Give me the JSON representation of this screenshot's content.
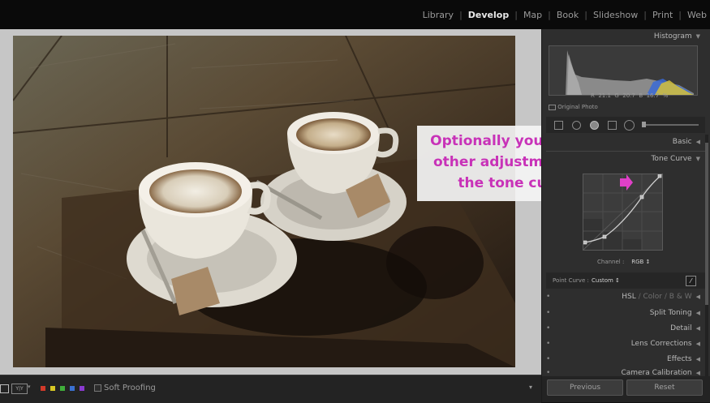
{
  "modules": [
    {
      "label": "Library",
      "active": false
    },
    {
      "label": "Develop",
      "active": true
    },
    {
      "label": "Map",
      "active": false
    },
    {
      "label": "Book",
      "active": false
    },
    {
      "label": "Slideshow",
      "active": false
    },
    {
      "label": "Print",
      "active": false
    },
    {
      "label": "Web",
      "active": false
    }
  ],
  "panel": {
    "histogram": "Histogram",
    "rgb_readout": {
      "r_label": "R",
      "r": "21.1",
      "g_label": "G",
      "g": "20.7",
      "b_label": "B",
      "b": "16.7",
      "unit": "%"
    },
    "original_photo": "Original Photo",
    "basic": "Basic",
    "tone_curve": "Tone Curve",
    "channel_label": "Channel :",
    "channel_value": "RGB ↕",
    "point_curve_label": "Point Curve :",
    "point_curve_value": "Custom ↕",
    "hsl": "HSL",
    "color": "Color",
    "bw": "B & W",
    "split_toning": "Split Toning",
    "detail": "Detail",
    "lens_corrections": "Lens Corrections",
    "effects": "Effects",
    "camera_calibration": "Camera Calibration",
    "previous": "Previous",
    "reset": "Reset"
  },
  "toolbar": {
    "soft_proofing": "Soft Proofing",
    "color_labels": [
      "#d23a2a",
      "#d8c824",
      "#3fae3a",
      "#3a70d0",
      "#8a3ad0"
    ]
  },
  "callout": {
    "line1": "Optionally you can do",
    "line2": "other adjustments in",
    "line3": "the tone curve"
  }
}
